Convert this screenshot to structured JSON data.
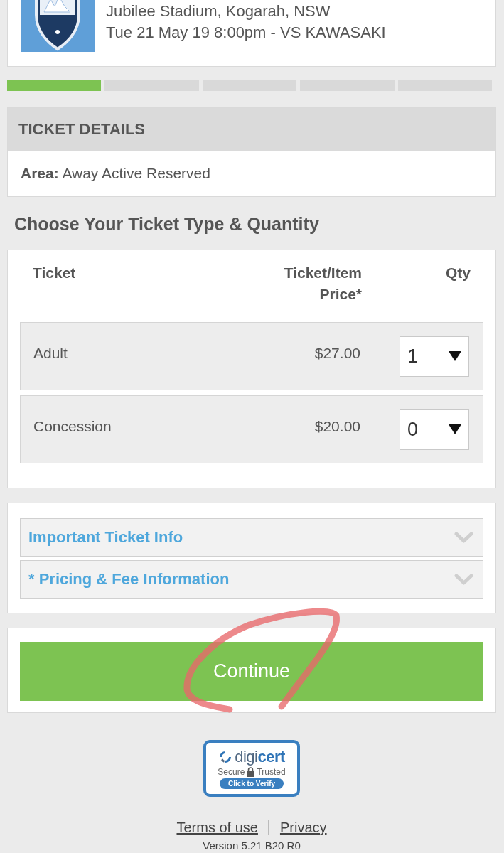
{
  "event": {
    "venue": "Jubilee Stadium, Kogarah, NSW",
    "datetime": "Tue 21 May 19 8:00pm - VS KAWASAKI"
  },
  "progress_steps": [
    {
      "complete": true
    },
    {
      "complete": false
    },
    {
      "complete": false
    },
    {
      "complete": false
    },
    {
      "complete": false
    }
  ],
  "ticket_details": {
    "title": "TICKET DETAILS",
    "area": "**Area:** Away Active Reserved"
  },
  "ticket_section": {
    "heading": "Choose Your Ticket Type & Quantity",
    "columns": [
      "Ticket",
      "Ticket/Item Price*",
      "Qty"
    ],
    "rows": [
      {
        "name": "Adult",
        "price": "$27.00",
        "qty": "1"
      },
      {
        "name": "Concession",
        "price": "$20.00",
        "qty": "0"
      }
    ]
  },
  "info_panels": [
    {
      "title": "Important Ticket Info",
      "expanded": false
    },
    {
      "title": "* Pricing & Fee Information",
      "expanded": false
    }
  ],
  "continue_button": {
    "label": "Continue",
    "circled": true
  },
  "seal": {
    "brand": [
      "digi",
      "cert"
    ],
    "secure": "Secure",
    "trusted": "Trusted",
    "verify": "Click to Verify"
  },
  "footer": {
    "links": [
      "Terms of use",
      "Privacy"
    ],
    "version": "Version 5.21 B20 R0"
  }
}
